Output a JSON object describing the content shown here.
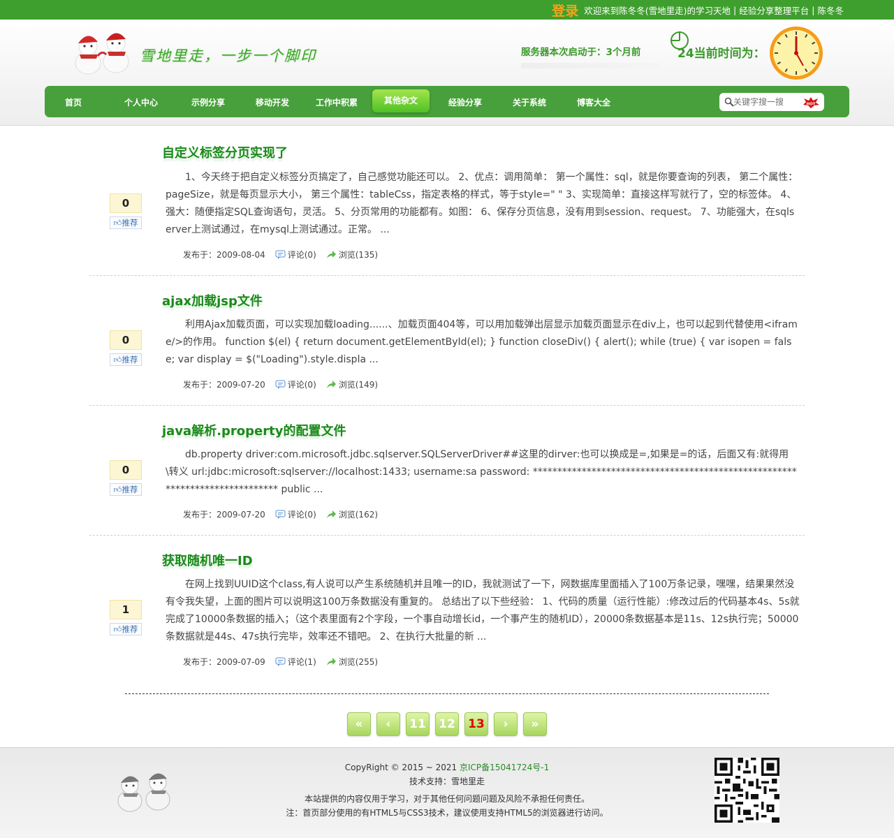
{
  "topbar": {
    "login": "登录",
    "welcome": "欢迎来到陈冬冬(雪地里走)的学习天地",
    "link_share": "经验分享整理平台",
    "link_author": "陈冬冬",
    "sep": "|"
  },
  "header": {
    "slogan": "雪地里走，一步一个脚印",
    "server_started": "服务器本次启动于：3个月前",
    "current_time": "24当前时间为："
  },
  "nav": {
    "items": [
      "首页",
      "个人中心",
      "示例分享",
      "移动开发",
      "工作中积累",
      "其他杂文",
      "经验分享",
      "关于系统",
      "博客大全"
    ],
    "active": "其他杂文",
    "search_placeholder": "关键字搜一搜",
    "hot_badge": "HOT"
  },
  "posts": [
    {
      "title": "自定义标签分页实现了",
      "votes": "0",
      "recommend": "推荐",
      "summary": "1、今天终于把自定义标签分页搞定了，自己感觉功能还可以。 2、优点：调用简单： 第一个属性：sql，就是你要查询的列表， 第二个属性：pageSize，就是每页显示大小， 第三个属性：tableCss，指定表格的样式，等于style=\" \" 3、实现简单：直接这样写就行了，空的标签体。 4、强大：随便指定SQL查询语句，灵活。 5、分页常用的功能都有。如图： 6、保存分页信息，没有用到session、request。 7、功能强大，在sqlserver上测试通过，在mysql上测试通过。正常。 ...",
      "date": "发布于：2009-08-04",
      "comments": "评论(0)",
      "views": "浏览(135)"
    },
    {
      "title": "ajax加载jsp文件",
      "votes": "0",
      "recommend": "推荐",
      "summary": "利用Ajax加载页面，可以实现加载loading......、加载页面404等，可以用加载弹出层显示加载页面显示在div上，也可以起到代替使用<iframe/>的作用。 function $(el) { return document.getElementById(el); } function closeDiv() { alert(); while (true) { var isopen = false; var display = $(\"Loading\").style.displa ...",
      "date": "发布于：2009-07-20",
      "comments": "评论(0)",
      "views": "浏览(149)"
    },
    {
      "title": "java解析.property的配置文件",
      "votes": "0",
      "recommend": "推荐",
      "summary": "db.property driver:com.microsoft.jdbc.sqlserver.SQLServerDriver##这里的dirver:也可以换成是=,如果是=的话，后面又有:就得用\\转义 url:jdbc:microsoft:sqlserver://localhost:1433; username:sa password: ***************************************************************************** public ...",
      "date": "发布于：2009-07-20",
      "comments": "评论(0)",
      "views": "浏览(162)"
    },
    {
      "title": "获取随机唯一ID",
      "votes": "1",
      "recommend": "推荐",
      "summary": "在网上找到UUID这个class,有人说可以产生系统随机并且唯一的ID，我就测试了一下，网数据库里面插入了100万条记录，嘿嘿，结果果然没有令我失望，上面的图片可以说明这100万条数据没有重复的。 总结出了以下些经验： 1、代码的质量（运行性能）:修改过后的代码基本4s、5s就完成了10000条数据的插入；（这个表里面有2个字段，一个事自动增长id，一个事产生的随机ID），20000条数据基本是11s、12s执行完；50000条数据就是44s、47s执行完毕，效率还不错吧。 2、在执行大批量的新 ...",
      "date": "发布于：2009-07-09",
      "comments": "评论(1)",
      "views": "浏览(255)"
    }
  ],
  "pager": {
    "first": "«",
    "prev": "‹",
    "pages": [
      "11",
      "12",
      "13"
    ],
    "current": "13",
    "next": "›",
    "last": "»"
  },
  "footer": {
    "copyright": "CopyRight © 2015 ~ 2021 ",
    "icp": "京ICP备15041724号-1",
    "support": "技术支持：雪地里走",
    "disclaimer": "本站提供的内容仅用于学习，对于其他任何问题问题及风险不承担任何责任。",
    "note": "注：首页部分使用的有HTML5与CSS3技术，建议使用支持HTML5的浏览器进行访问。"
  },
  "colors": {
    "brand_green": "#48a03c",
    "title_green": "#1a8a1a",
    "login_orange": "#f7a21b",
    "current_page_red": "#e00000"
  }
}
